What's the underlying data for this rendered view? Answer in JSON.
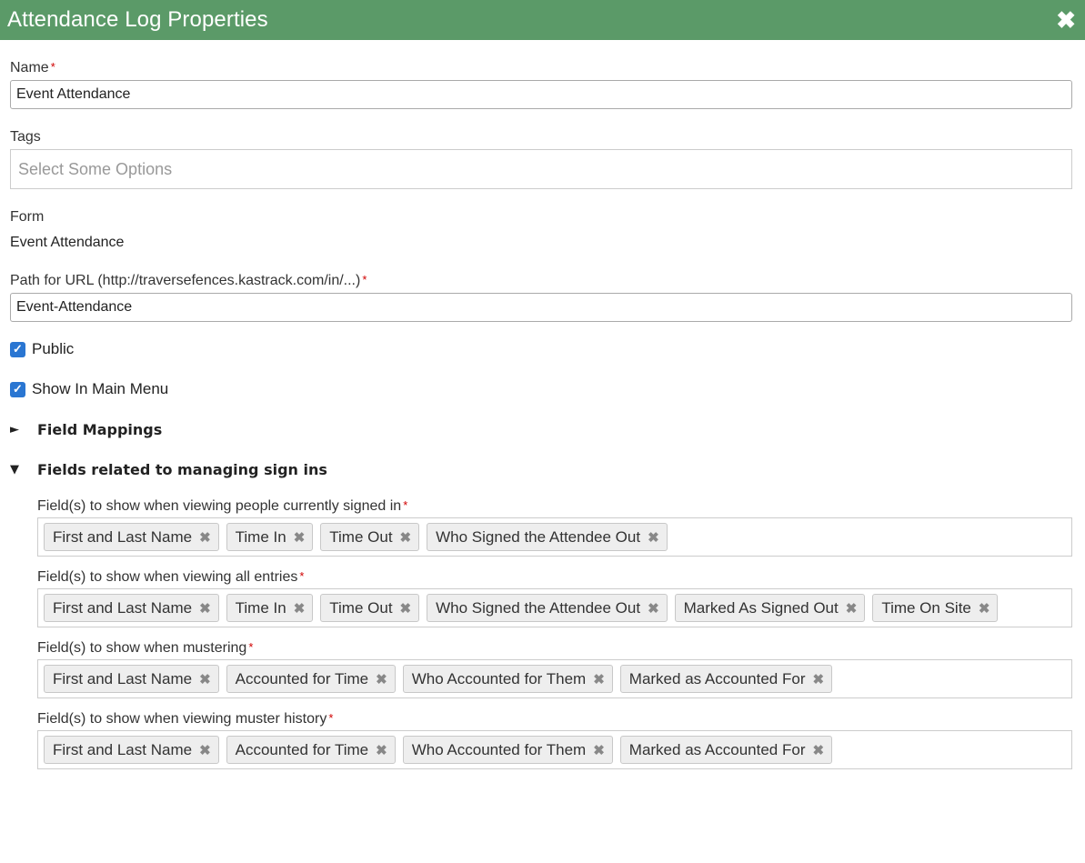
{
  "window": {
    "title": "Attendance Log Properties"
  },
  "name": {
    "label": "Name",
    "value": "Event Attendance"
  },
  "tags": {
    "label": "Tags",
    "placeholder": "Select Some Options"
  },
  "form": {
    "label": "Form",
    "value": "Event Attendance"
  },
  "path": {
    "label": "Path for URL (http://traversefences.kastrack.com/in/...)",
    "value": "Event-Attendance"
  },
  "public": {
    "label": "Public",
    "checked": true
  },
  "show_in_menu": {
    "label": "Show In Main Menu",
    "checked": true
  },
  "required_mark": "*",
  "remove_glyph": "✖",
  "sections": {
    "field_mappings": {
      "label": "Field Mappings",
      "expanded": false,
      "arrow": "►"
    },
    "sign_ins": {
      "label": "Fields related to managing sign ins",
      "expanded": true,
      "arrow": "▼"
    }
  },
  "fieldsets": {
    "currently_signed_in": {
      "label": "Field(s) to show when viewing people currently signed in",
      "chips": [
        "First and Last Name",
        "Time In",
        "Time Out",
        "Who Signed the Attendee Out"
      ]
    },
    "all_entries": {
      "label": "Field(s) to show when viewing all entries",
      "chips": [
        "First and Last Name",
        "Time In",
        "Time Out",
        "Who Signed the Attendee Out",
        "Marked As Signed Out",
        "Time On Site"
      ]
    },
    "mustering": {
      "label": "Field(s) to show when mustering",
      "chips": [
        "First and Last Name",
        "Accounted for Time",
        "Who Accounted for Them",
        "Marked as Accounted For"
      ]
    },
    "muster_history": {
      "label": "Field(s) to show when viewing muster history",
      "chips": [
        "First and Last Name",
        "Accounted for Time",
        "Who Accounted for Them",
        "Marked as Accounted For"
      ]
    }
  },
  "colors": {
    "titlebar": "#5b9a68",
    "checkbox": "#2a76d2",
    "required": "#d00000"
  }
}
